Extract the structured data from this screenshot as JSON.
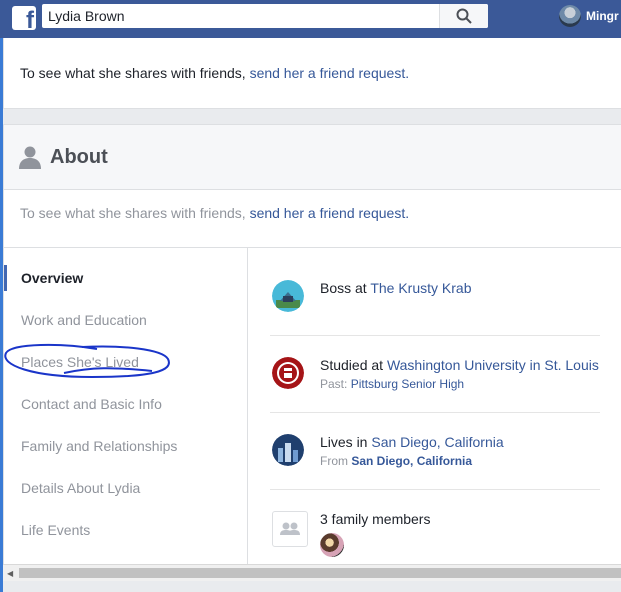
{
  "topbar": {
    "logo_letter": "f",
    "search_value": "Lydia Brown",
    "search_icon": "search-icon",
    "username": "Mingr"
  },
  "friend_prompt": {
    "text": "To see what she shares with friends, ",
    "link": "send her a friend request."
  },
  "about": {
    "title": "About",
    "icon": "person-icon",
    "friend_text": "To see what she shares with friends, ",
    "friend_link": "send her a friend request."
  },
  "sidebar": {
    "items": [
      {
        "label": "Overview",
        "active": true
      },
      {
        "label": "Work and Education"
      },
      {
        "label": "Places She's Lived"
      },
      {
        "label": "Contact and Basic Info"
      },
      {
        "label": "Family and Relationships"
      },
      {
        "label": "Details About Lydia"
      },
      {
        "label": "Life Events"
      }
    ]
  },
  "overview": {
    "work": {
      "prefix": "Boss at ",
      "link": "The Krusty Krab"
    },
    "education": {
      "prefix": "Studied at ",
      "link": "Washington University in St. Louis",
      "past_label": "Past: ",
      "past_link": "Pittsburg Senior High"
    },
    "lives": {
      "prefix": "Lives in ",
      "link": "San Diego, California",
      "from_label": "From ",
      "from_link": "San Diego, California"
    },
    "family": {
      "text": "3 family members",
      "icon": "people-icon"
    }
  },
  "colors": {
    "brand": "#3b5998",
    "link": "#365899",
    "muted": "#90949c",
    "annotation": "#1a35c9"
  }
}
